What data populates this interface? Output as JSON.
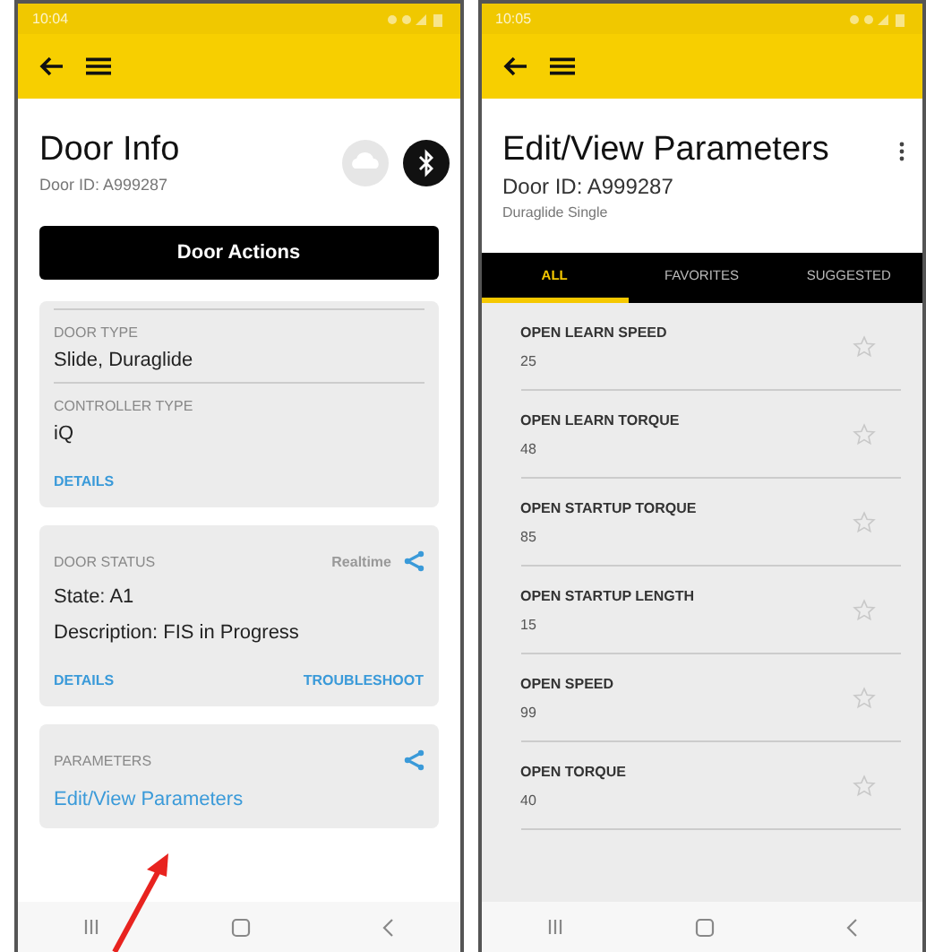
{
  "door_info_screen": {
    "status_bar": {
      "time": "10:04"
    },
    "title": "Door Info",
    "door_id": "Door ID: A999287",
    "actions_button": "Door Actions",
    "info_card": {
      "fields": [
        {
          "label": "DOOR TYPE",
          "value": "Slide, Duraglide"
        },
        {
          "label": "CONTROLLER TYPE",
          "value": "iQ"
        }
      ],
      "link": "DETAILS"
    },
    "status_card": {
      "label": "DOOR STATUS",
      "mode": "Realtime",
      "lines": [
        "State: A1",
        "Description: FIS in Progress"
      ],
      "links": [
        "DETAILS",
        "TROUBLESHOOT"
      ]
    },
    "parameters_card": {
      "label": "PARAMETERS",
      "link": "Edit/View Parameters"
    }
  },
  "parameters_screen": {
    "status_bar": {
      "time": "10:05"
    },
    "title": "Edit/View Parameters",
    "door_id": "Door ID: A999287",
    "subtitle": "Duraglide Single",
    "tabs": [
      {
        "label": "ALL",
        "selected": true
      },
      {
        "label": "FAVORITES",
        "selected": false
      },
      {
        "label": "SUGGESTED",
        "selected": false
      }
    ],
    "parameters": [
      {
        "name": "OPEN LEARN SPEED",
        "value": "25",
        "favorite": false
      },
      {
        "name": "OPEN LEARN TORQUE",
        "value": "48",
        "favorite": false
      },
      {
        "name": "OPEN STARTUP TORQUE",
        "value": "85",
        "favorite": false
      },
      {
        "name": "OPEN STARTUP LENGTH",
        "value": "15",
        "favorite": false
      },
      {
        "name": "OPEN SPEED",
        "value": "99",
        "favorite": false
      },
      {
        "name": "OPEN TORQUE",
        "value": "40",
        "favorite": false
      }
    ]
  }
}
